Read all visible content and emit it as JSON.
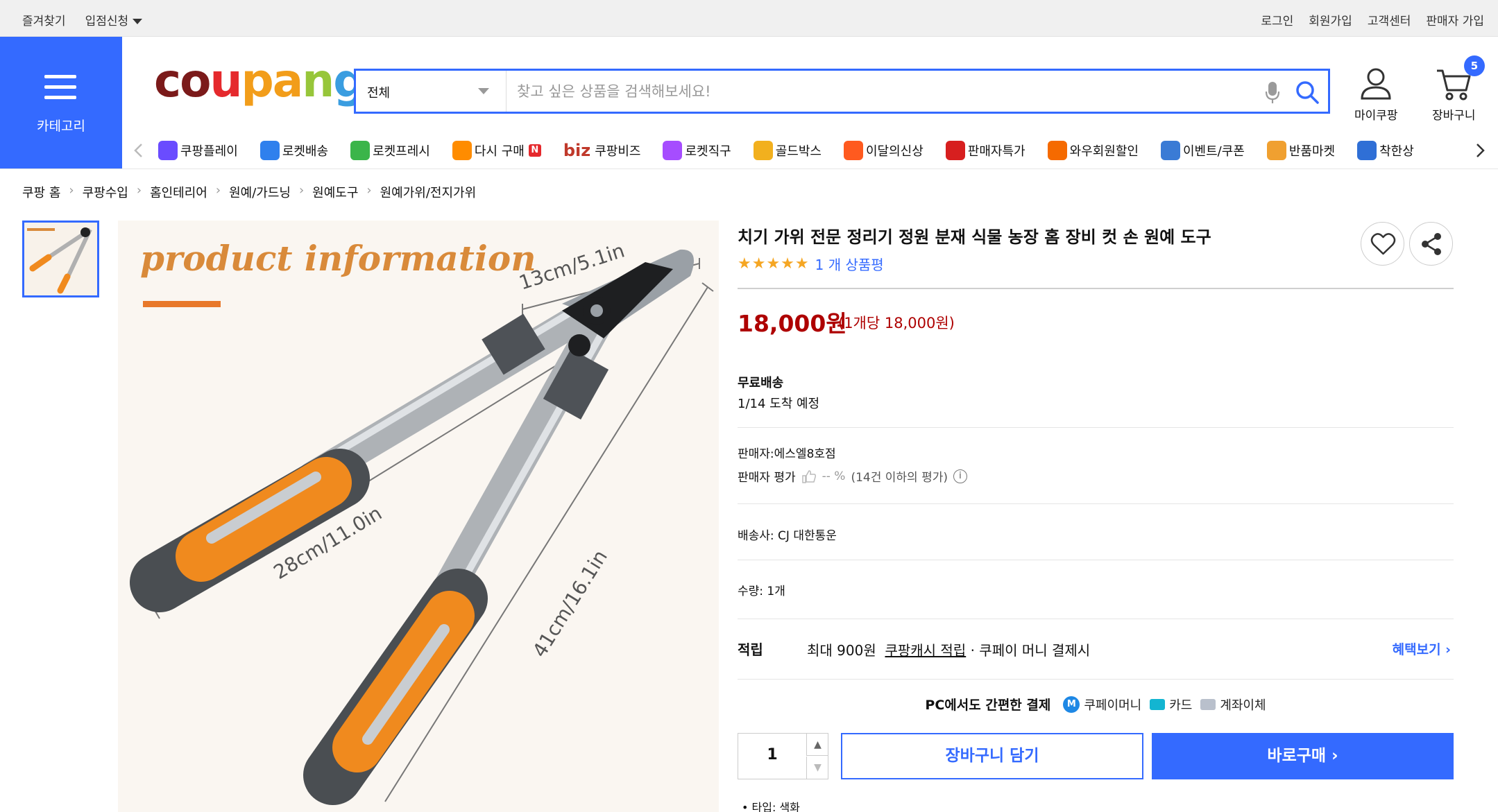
{
  "topbar": {
    "bookmark": "즐겨찾기",
    "apply": "입점신청",
    "login": "로그인",
    "signup": "회원가입",
    "support": "고객센터",
    "seller_signup": "판매자 가입"
  },
  "category": {
    "label": "카테고리"
  },
  "logo": {
    "p1": "c",
    "p2": "o",
    "p3": "u",
    "p4": "p",
    "p5": "a",
    "p6": "n",
    "p7": "g"
  },
  "search": {
    "scope": "전체",
    "placeholder": "찾고 싶은 상품을 검색해보세요!"
  },
  "header_icons": {
    "my": "마이쿠팡",
    "cart": "장바구니",
    "cart_count": "5"
  },
  "nav": [
    {
      "label": "쿠팡플레이",
      "icon": "play-icon",
      "color": "#6a4cff"
    },
    {
      "label": "로켓배송",
      "icon": "rocket-icon",
      "color": "#2f80ed"
    },
    {
      "label": "로켓프레시",
      "icon": "rocket-fresh-icon",
      "color": "#3bb54a"
    },
    {
      "label": "다시 구매",
      "icon": "basket-icon",
      "color": "#ff8c00",
      "badge": "N"
    },
    {
      "label": "쿠팡비즈",
      "icon": "biz-icon",
      "prefix": "biz"
    },
    {
      "label": "로켓직구",
      "icon": "rocket-global-icon",
      "color": "#a64dff"
    },
    {
      "label": "골드박스",
      "icon": "goldbox-icon",
      "color": "#f2b01e"
    },
    {
      "label": "이달의신상",
      "icon": "new-icon",
      "color": "#ff5a1f"
    },
    {
      "label": "판매자특가",
      "icon": "percent-icon",
      "color": "#d71f1f"
    },
    {
      "label": "와우회원할인",
      "icon": "wow-icon",
      "color": "#f56a00"
    },
    {
      "label": "이벤트/쿠폰",
      "icon": "coupon-icon",
      "color": "#3a7bd5"
    },
    {
      "label": "반품마켓",
      "icon": "return-icon",
      "color": "#f0a030"
    },
    {
      "label": "착한상",
      "icon": "store-icon",
      "color": "#2f6fd6"
    }
  ],
  "breadcrumb": [
    "쿠팡 홈",
    "쿠팡수입",
    "홈인테리어",
    "원예/가드닝",
    "원예도구",
    "원예가위/전지가위"
  ],
  "image": {
    "heading": "product information",
    "dim_blade": "13cm/5.1in",
    "dim_handle": "28cm/11.0in",
    "dim_total": "41cm/16.1in"
  },
  "product": {
    "title": "치기 가위 전문 정리기 정원 분재 식물 농장 홈 장비 컷 손 원예 도구",
    "stars": "★★★★★",
    "review_count": "1 개 상품평",
    "price": "18,000원",
    "unit_price": "(1개당 18,000원)",
    "shipping_title": "무료배송",
    "shipping_date": "1/14 도착 예정",
    "seller": "판매자:에스엘8호점",
    "seller_rating_label": "판매자 평가",
    "seller_rating_value": "-- %",
    "seller_rating_note": "(14건 이하의 평가)",
    "carrier": "배송사:  CJ 대한통운",
    "quantity_label": "수량:  1개",
    "reward_title": "적립",
    "reward_prefix": "최대 900원",
    "reward_link_text": "쿠팡캐시 적립",
    "reward_suffix": " · 쿠페이 머니 결제시",
    "benefit_link": "혜택보기 ›",
    "pay_title": "PC에서도 간편한 결제",
    "pay_money": "쿠페이머니",
    "pay_money_badge": "M",
    "pay_card": "카드",
    "pay_bank": "계좌이체",
    "qty_value": "1",
    "cart_button": "장바구니 담기",
    "buy_button": "바로구매 ›",
    "option": "타입: 색화"
  }
}
